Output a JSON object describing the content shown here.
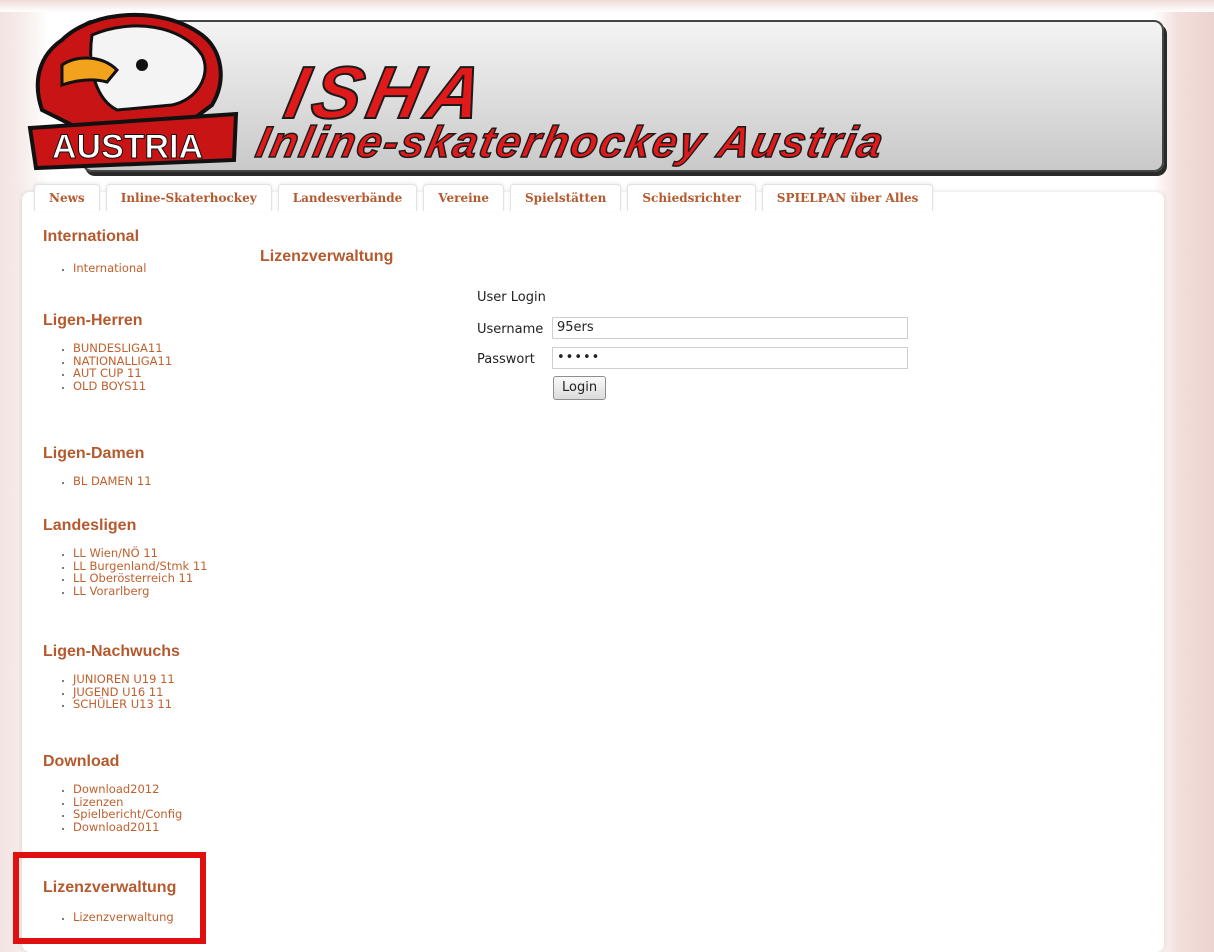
{
  "banner": {
    "logo_text": "AUSTRIA",
    "title": "ISHA",
    "subtitle": "Inline-skaterhockey Austria"
  },
  "tabs": [
    {
      "label": "News"
    },
    {
      "label": "Inline-Skaterhockey"
    },
    {
      "label": "Landesverbände"
    },
    {
      "label": "Vereine"
    },
    {
      "label": "Spielstätten"
    },
    {
      "label": "Schiedsrichter"
    },
    {
      "label": "SPIELPAN über Alles"
    }
  ],
  "sidebar": {
    "sections": [
      {
        "title": "International",
        "items": [
          "International"
        ]
      },
      {
        "title": "Ligen-Herren",
        "items": [
          "BUNDESLIGA11",
          "NATIONALLIGA11",
          "AUT CUP 11",
          "OLD BOYS11"
        ]
      },
      {
        "title": "Ligen-Damen",
        "items": [
          "BL DAMEN 11"
        ]
      },
      {
        "title": "Landesligen",
        "items": [
          "LL Wien/NÖ 11",
          "LL Burgenland/Stmk 11",
          "LL Oberösterreich 11",
          "LL Vorarlberg"
        ]
      },
      {
        "title": "Ligen-Nachwuchs",
        "items": [
          "JUNIOREN U19 11",
          "JUGEND U16 11",
          "SCHÜLER U13 11"
        ]
      },
      {
        "title": "Download",
        "items": [
          "Download2012",
          "Lizenzen",
          "Spielbericht/Config",
          "Download2011"
        ]
      },
      {
        "title": "Lizenzverwaltung",
        "items": [
          "Lizenzverwaltung"
        ]
      }
    ]
  },
  "main": {
    "title": "Lizenzverwaltung",
    "login": {
      "heading": "User Login",
      "username_label": "Username",
      "username_value": "95ers",
      "password_label": "Passwort",
      "password_value": "•••••",
      "button_label": "Login"
    }
  },
  "colors": {
    "accent": "#b45a2e",
    "link": "#c0602e",
    "highlight": "#e01010",
    "brand_red": "#e01a1a"
  }
}
